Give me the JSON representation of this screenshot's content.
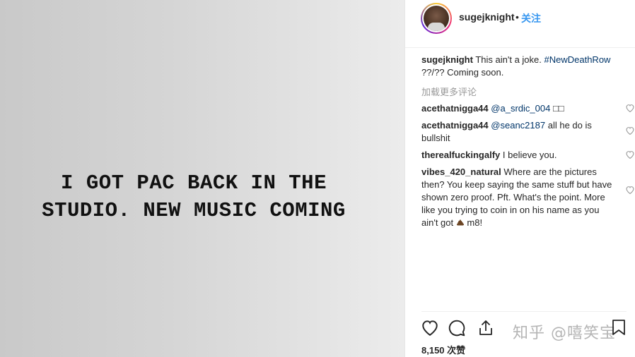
{
  "photo": {
    "line1": "I GOT PAC BACK IN THE",
    "line2": "STUDIO. NEW MUSIC COMING"
  },
  "header": {
    "username": "sugejknight",
    "separator": "•",
    "follow_label": "关注"
  },
  "caption": {
    "username": "sugejknight",
    "text": "This ain't a joke.",
    "hashtag": "#NewDeathRow",
    "rest": "??/?? Coming soon."
  },
  "load_more": "加载更多评论",
  "comments": [
    {
      "user": "acethatnigga44",
      "mention": "@a_srdic_004",
      "text": "□□"
    },
    {
      "user": "acethatnigga44",
      "mention": "@seanc2187",
      "text": "all he do is bullshit"
    },
    {
      "user": "therealfuckingalfy",
      "mention": "",
      "text": "I believe you."
    },
    {
      "user": "vibes_420_natural",
      "mention": "",
      "text": "Where are the pictures then? You keep saying the same stuff but have shown zero proof. Pft. What's the point. More like you trying to coin in on his name as you ain't got",
      "tail": "m8!"
    }
  ],
  "watermark": "知乎 @嘻笑宝",
  "likes": "8,150 次赞",
  "icons": {
    "like": "heart-icon",
    "comment": "comment-icon",
    "share": "share-icon",
    "save": "bookmark-icon",
    "poop": "poop-emoji-icon"
  },
  "colors": {
    "link": "#003569",
    "follow": "#3897f0",
    "text": "#262626",
    "muted": "#999999"
  }
}
